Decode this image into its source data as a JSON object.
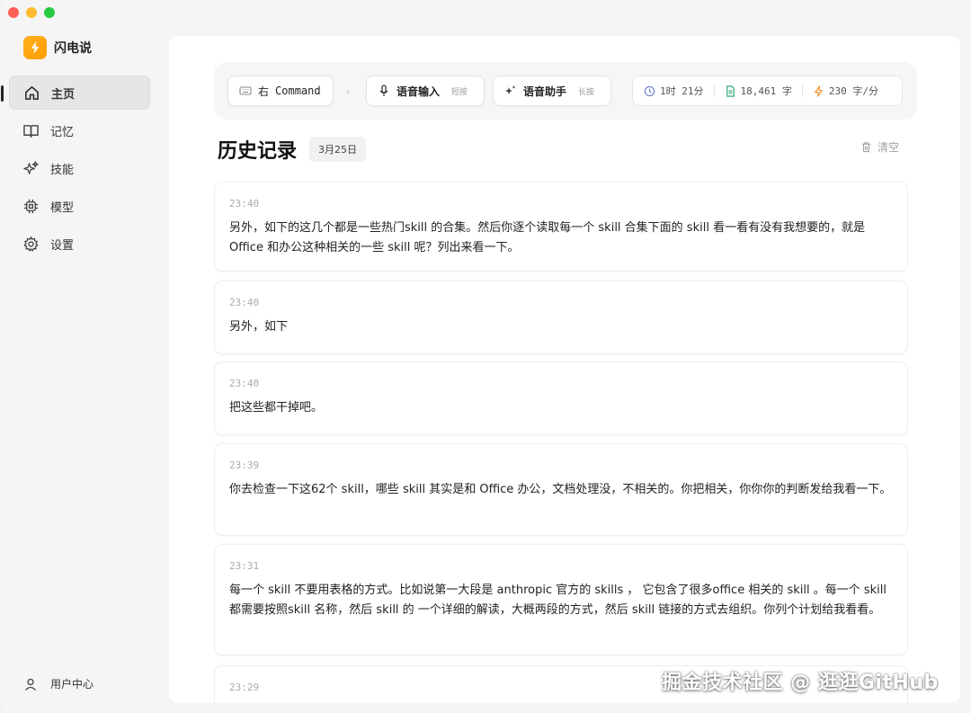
{
  "app": {
    "name": "闪电说"
  },
  "sidebar": {
    "items": [
      {
        "label": "主页",
        "icon": "home-icon",
        "active": true
      },
      {
        "label": "记忆",
        "icon": "book-icon",
        "active": false
      },
      {
        "label": "技能",
        "icon": "sparkle-icon",
        "active": false
      },
      {
        "label": "模型",
        "icon": "chip-icon",
        "active": false
      },
      {
        "label": "设置",
        "icon": "gear-icon",
        "active": false
      }
    ],
    "user_center": "用户中心"
  },
  "toolbar": {
    "command": {
      "key": "右",
      "label": "Command"
    },
    "voice_input": {
      "label": "语音输入",
      "hint": "短按"
    },
    "voice_assistant": {
      "label": "语音助手",
      "hint": "长按"
    },
    "stats": {
      "duration": "1时 21分",
      "chars": "18,461 字",
      "speed": "230 字/分"
    }
  },
  "history": {
    "title": "历史记录",
    "date": "3月25日",
    "clear_label": "清空",
    "records": [
      {
        "time": "23:40",
        "text": "另外，如下的这几个都是一些热门skill 的合集。然后你逐个读取每一个 skill 合集下面的 skill 看一看有没有我想要的，就是 Office 和办公这种相关的一些 skill 呢？列出来看一下。"
      },
      {
        "time": "23:40",
        "text": "另外，如下"
      },
      {
        "time": "23:40",
        "text": "把这些都干掉吧。"
      },
      {
        "time": "23:39",
        "text": "你去检查一下这62个 skill，哪些 skill 其实是和 Office 办公，文档处理没，不相关的。你把相关，你你你的判断发给我看一下。"
      },
      {
        "time": "23:31",
        "text": "每一个 skill 不要用表格的方式。比如说第一大段是 anthropic 官方的 skills ， 它包含了很多office 相关的 skill 。每一个 skill 都需要按照skill 名称，然后 skill 的 一个详细的解读，大概两段的方式，然后 skill 链接的方式去组织。你列个计划给我看看。"
      },
      {
        "time": "23:29",
        "text": ""
      }
    ]
  },
  "watermark": "掘金技术社区 @ 逛逛GitHub",
  "colors": {
    "accent": "#ffa50a",
    "active_bg": "#e6e6e8",
    "stat_doc": "#22a06b",
    "stat_speed": "#f08a24",
    "stat_clock": "#6b7cc9"
  }
}
